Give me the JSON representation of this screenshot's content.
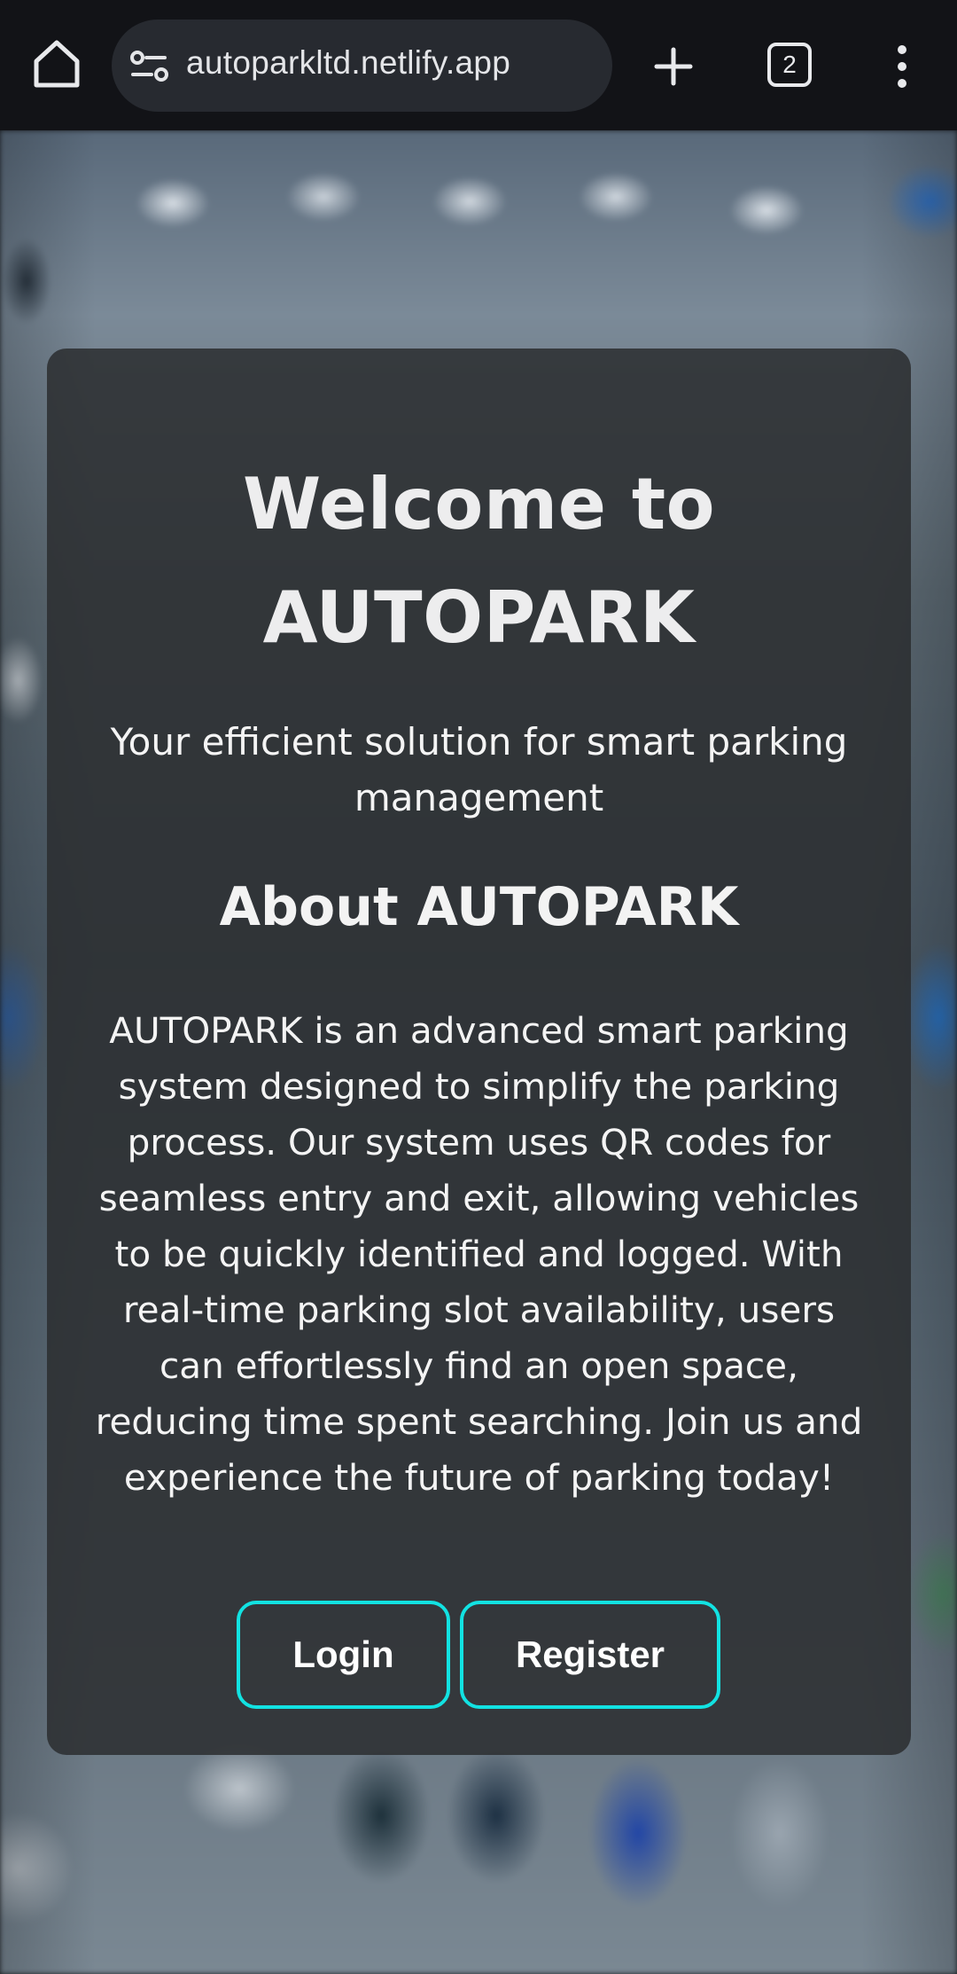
{
  "browser": {
    "url": "autoparkltd.netlify.app",
    "tab_count": "2",
    "icons": {
      "home": "home-icon",
      "site_info": "site-settings-icon",
      "new_tab": "plus-icon",
      "tabs": "tab-switcher-icon",
      "menu": "more-vertical-icon"
    }
  },
  "hero": {
    "title_line1": "Welcome to",
    "title_line2": "AUTOPARK",
    "subtitle": "Your efficient solution for smart parking management"
  },
  "about": {
    "heading": "About AUTOPARK",
    "body": "AUTOPARK is an advanced smart parking system designed to simplify the parking process. Our system uses QR codes for seamless entry and exit, allowing vehicles to be quickly identified and logged. With real-time parking slot availability, users can effortlessly find an open space, reducing time spent searching. Join us and experience the future of parking today!"
  },
  "actions": {
    "login_label": "Login",
    "register_label": "Register"
  },
  "colors": {
    "accent": "#12e2e2",
    "card": "#2b2d30",
    "chrome": "#121317"
  }
}
